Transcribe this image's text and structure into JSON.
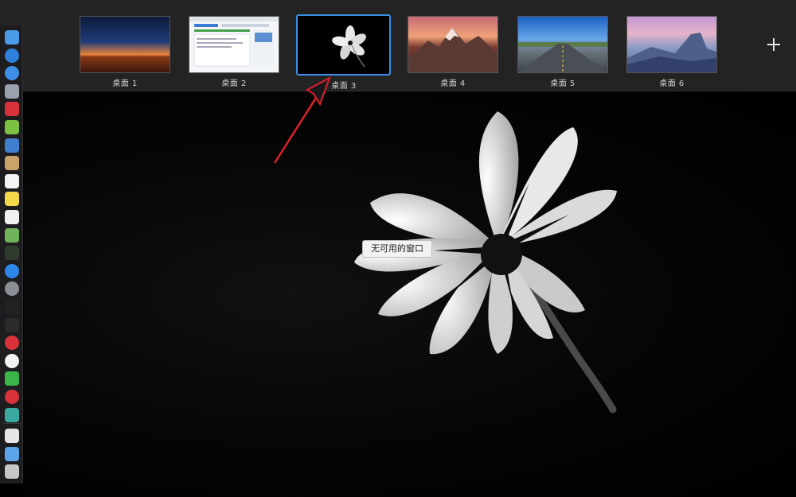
{
  "spaces": [
    {
      "label": "桌面 1",
      "selected": false
    },
    {
      "label": "桌面 2",
      "selected": false
    },
    {
      "label": "桌面 3",
      "selected": true
    },
    {
      "label": "桌面 4",
      "selected": false
    },
    {
      "label": "桌面 5",
      "selected": false
    },
    {
      "label": "桌面 6",
      "selected": false
    }
  ],
  "add_space_icon": "plus-icon",
  "tooltip": {
    "text": "无可用的窗口"
  },
  "annotation": {
    "icon": "red-arrow-icon",
    "color": "#e0202a"
  },
  "selection_color": "#3a8ee6",
  "dock": {
    "icons": [
      {
        "name": "finder-icon",
        "color": "#4a9be8"
      },
      {
        "name": "compass-icon",
        "color": "#2f7fdc"
      },
      {
        "name": "safari-icon",
        "color": "#3c8ee6"
      },
      {
        "name": "launchpad-icon",
        "color": "#9aa3ad"
      },
      {
        "name": "app-red-icon",
        "color": "#d8323a"
      },
      {
        "name": "android-icon",
        "color": "#7cc142"
      },
      {
        "name": "preview-icon",
        "color": "#3f7fd0"
      },
      {
        "name": "notebook-icon",
        "color": "#c9a46a"
      },
      {
        "name": "calendar-icon",
        "color": "#f4f4f4"
      },
      {
        "name": "notes-icon",
        "color": "#f3d84b"
      },
      {
        "name": "reminders-icon",
        "color": "#f0f0f0"
      },
      {
        "name": "maps-icon",
        "color": "#6fb35a"
      },
      {
        "name": "terminal-green-icon",
        "color": "#2f3b2f"
      },
      {
        "name": "app-store-icon",
        "color": "#2e86e8"
      },
      {
        "name": "system-preferences-icon",
        "color": "#8a8f96"
      },
      {
        "name": "activity-monitor-icon",
        "color": "#222"
      },
      {
        "name": "terminal-icon",
        "color": "#2b2b2b"
      },
      {
        "name": "vivaldi-icon",
        "color": "#d8323a"
      },
      {
        "name": "yandex-icon",
        "color": "#f2f2f2"
      },
      {
        "name": "wechat-icon",
        "color": "#39b54a"
      },
      {
        "name": "netease-music-icon",
        "color": "#d8323a"
      },
      {
        "name": "app-teal-icon",
        "color": "#3aa8a0"
      },
      {
        "name": "music-icon",
        "color": "#e6e6e6"
      },
      {
        "name": "folder-icon",
        "color": "#5aa6e8"
      },
      {
        "name": "trash-icon",
        "color": "#c7c7c7"
      }
    ]
  }
}
